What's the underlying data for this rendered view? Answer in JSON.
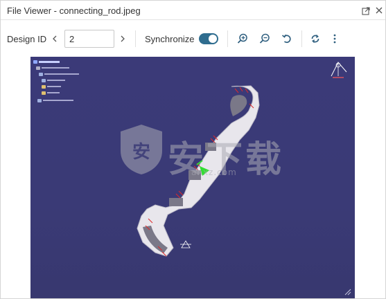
{
  "window": {
    "title": "File Viewer - connecting_rod.jpeg",
    "popout_icon": "popout-icon",
    "close_icon": "close-icon"
  },
  "toolbar": {
    "design_id_label": "Design ID",
    "design_id_value": "2",
    "prev_icon": "chevron-left-icon",
    "next_icon": "chevron-right-icon",
    "synchronize_label": "Synchronize",
    "synchronize_on": true,
    "accent_color": "#2f6d8f",
    "zoom_in_icon": "zoom-in-icon",
    "zoom_out_icon": "zoom-out-icon",
    "reset_icon": "rotate-left-icon",
    "sync_icon": "sync-icon",
    "more_icon": "more-vertical-icon"
  },
  "viewer": {
    "image_name": "connecting_rod.jpeg",
    "background_color": "#3a3a76",
    "part_color": "#e8e6ec",
    "watermark": {
      "main": "安下载",
      "sub": "anxz.com"
    }
  }
}
